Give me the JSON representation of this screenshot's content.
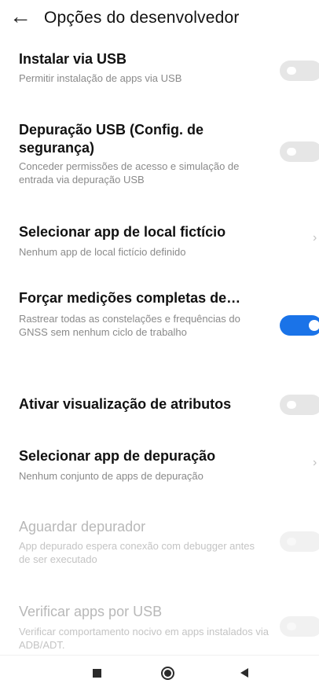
{
  "header": {
    "back_icon": "←",
    "title": "Opções do desenvolvedor"
  },
  "items": [
    {
      "title": "Instalar via USB",
      "subtitle": "Permitir instalação de apps via USB",
      "control": "toggle",
      "on": false,
      "enabled": true
    },
    {
      "title": "Depuração USB (Config. de segurança)",
      "subtitle": "Conceder permissões de acesso e simulação de entrada via depuração USB",
      "control": "toggle",
      "on": false,
      "enabled": true
    },
    {
      "title": "Selecionar app de local fictício",
      "subtitle": "Nenhum app de local fictício definido",
      "control": "chevron",
      "enabled": true
    },
    {
      "title": "Forçar medições completas de…",
      "subtitle": "Rastrear todas as constelações e frequências do GNSS sem nenhum ciclo de trabalho",
      "control": "toggle",
      "on": true,
      "enabled": true
    },
    {
      "title": "Ativar visualização de atributos",
      "subtitle": "",
      "control": "toggle",
      "on": false,
      "enabled": true
    },
    {
      "title": "Selecionar app de depuração",
      "subtitle": "Nenhum conjunto de apps de depuração",
      "control": "chevron",
      "enabled": true
    },
    {
      "title": "Aguardar depurador",
      "subtitle": "App depurado espera conexão com debugger antes de ser executado",
      "control": "toggle",
      "on": false,
      "enabled": false
    },
    {
      "title": "Verificar apps por USB",
      "subtitle": "Verificar comportamento nocivo em apps instalados via ADB/ADT.",
      "control": "toggle",
      "on": false,
      "enabled": false
    }
  ],
  "chevron_glyph": "›",
  "navbar": {
    "icons": [
      "recents-square-icon",
      "home-circle-icon",
      "back-triangle-icon"
    ]
  },
  "colors": {
    "accent": "#1a73e8",
    "toggle_off": "#e6e6e6",
    "subtitle": "#8a8a8a",
    "disabled_text": "#b8b8b8"
  }
}
